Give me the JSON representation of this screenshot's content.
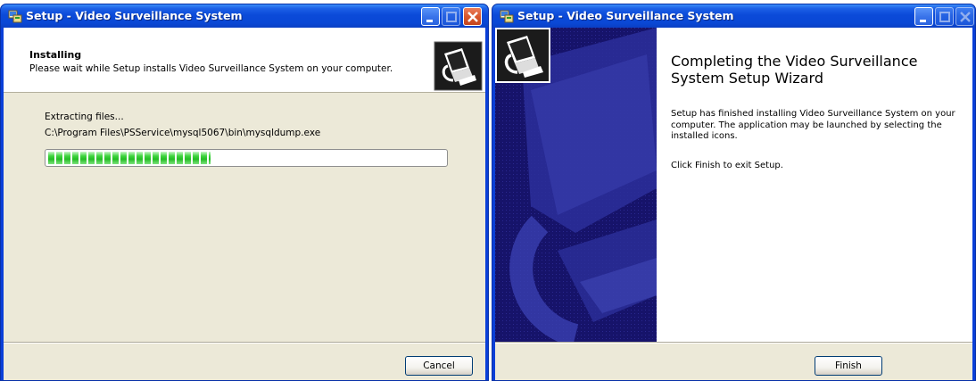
{
  "left_window": {
    "title": "Setup - Video Surveillance System",
    "header": {
      "title": "Installing",
      "subtitle": "Please wait while Setup installs Video Surveillance System on your computer."
    },
    "status_label": "Extracting files...",
    "status_path": "C:\\Program Files\\PSService\\mysql5067\\bin\\mysqldump.exe",
    "progress_percent": 41,
    "cancel_label": "Cancel"
  },
  "right_window": {
    "title": "Setup - Video Surveillance System",
    "heading": "Completing the Video Surveillance System Setup Wizard",
    "body": "Setup has finished installing Video Surveillance System on your computer. The application may be launched by selecting the installed icons.",
    "exit_text": "Click Finish to exit Setup.",
    "finish_label": "Finish"
  },
  "colors": {
    "titlebar_blue": "#0a48d5",
    "side_panel_navy": "#16136a",
    "progress_green": "#24bd24"
  },
  "icons": [
    "setup-app-icon",
    "minimize-icon",
    "maximize-icon",
    "close-icon",
    "installer-computer-icon"
  ]
}
